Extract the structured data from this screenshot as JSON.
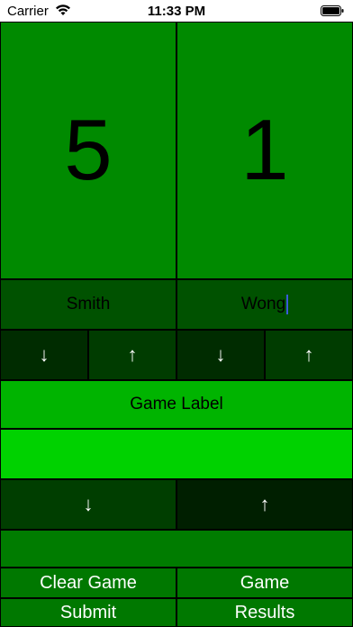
{
  "status_bar": {
    "carrier": "Carrier",
    "time": "11:33 PM"
  },
  "scoreboard": {
    "player_left": {
      "score": "5",
      "name": "Smith"
    },
    "player_right": {
      "score": "1",
      "name": "Wong"
    }
  },
  "controls": {
    "down_arrow": "↓",
    "up_arrow": "↑",
    "game_label": "Game Label",
    "clear_game": "Clear Game",
    "game": "Game",
    "submit": "Submit",
    "results": "Results"
  },
  "colors": {
    "score_tile": "#008a00",
    "name_tile": "#005200",
    "game_label": "#00b400",
    "bright_bar": "#00d200",
    "bottom_button": "#007800"
  }
}
